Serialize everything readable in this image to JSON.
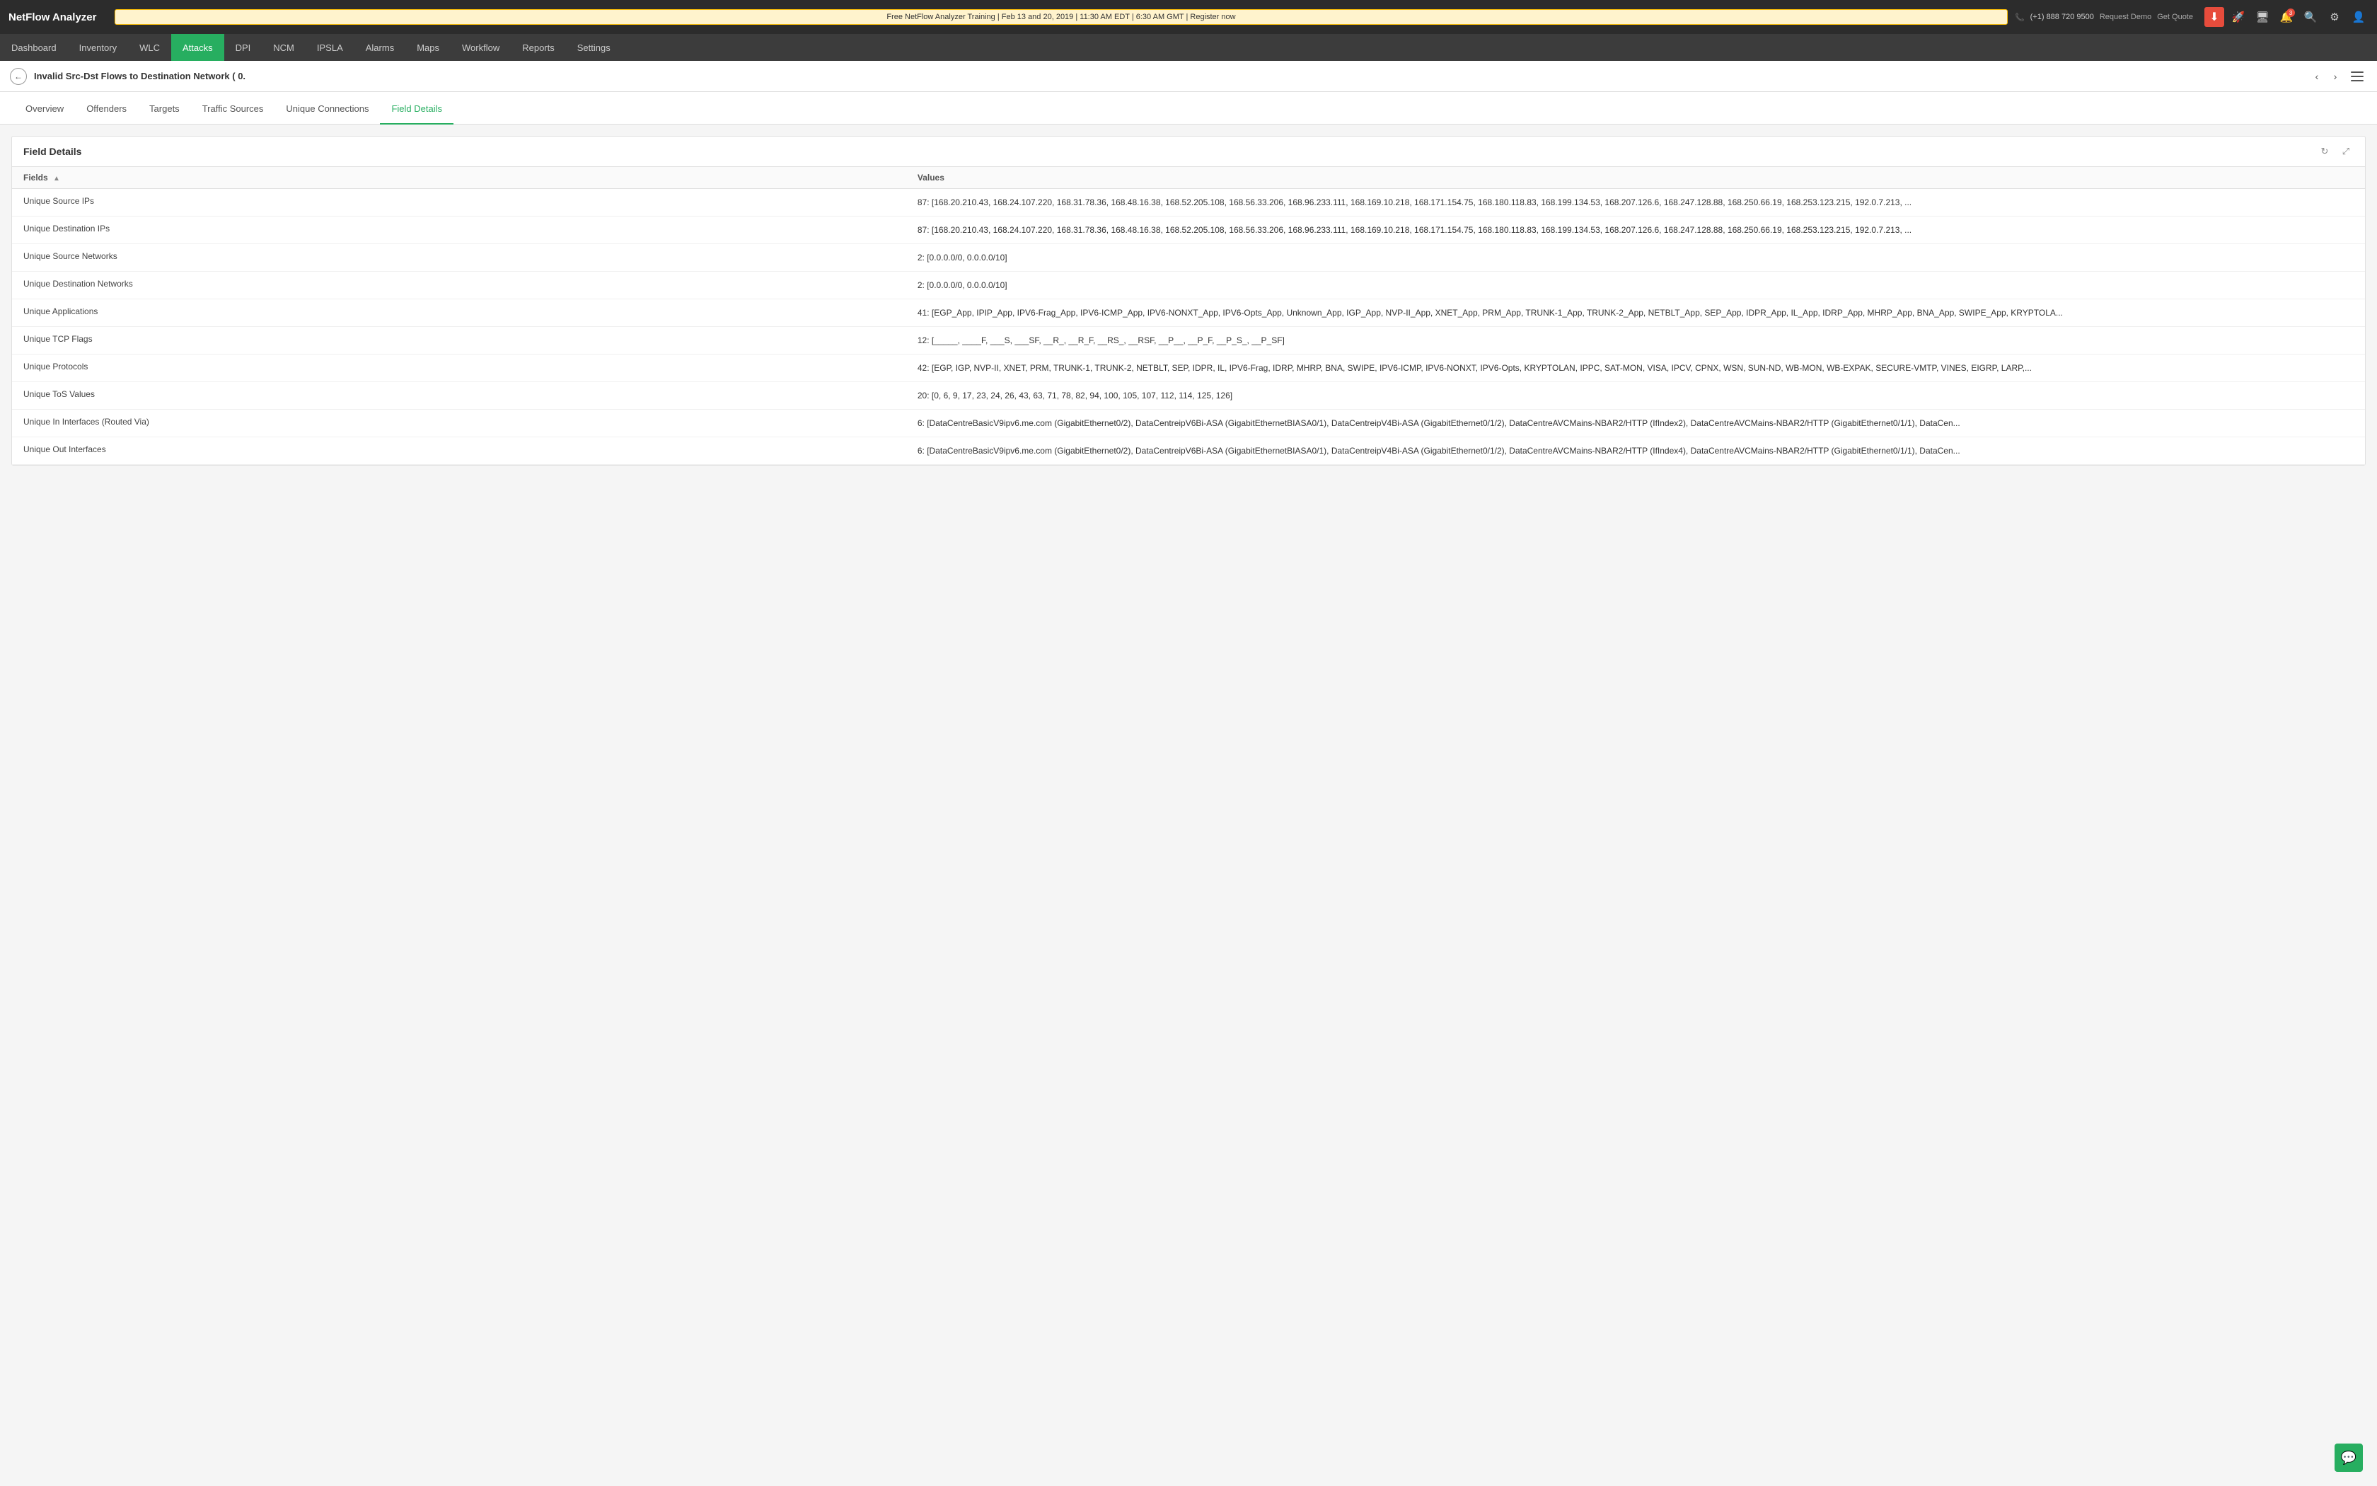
{
  "app": {
    "logo": "NetFlow Analyzer"
  },
  "announcement": {
    "text": "Free NetFlow Analyzer Training | Feb 13 and 20, 2019 | 11:30 AM EDT | 6:30 AM GMT | Register now"
  },
  "topActions": {
    "phone": "(+1) 888 720 9500",
    "request_demo": "Request Demo",
    "get_quote": "Get Quote"
  },
  "nav": {
    "items": [
      {
        "label": "Dashboard",
        "active": false
      },
      {
        "label": "Inventory",
        "active": false
      },
      {
        "label": "WLC",
        "active": false
      },
      {
        "label": "Attacks",
        "active": true
      },
      {
        "label": "DPI",
        "active": false
      },
      {
        "label": "NCM",
        "active": false
      },
      {
        "label": "IPSLA",
        "active": false
      },
      {
        "label": "Alarms",
        "active": false
      },
      {
        "label": "Maps",
        "active": false
      },
      {
        "label": "Workflow",
        "active": false
      },
      {
        "label": "Reports",
        "active": false
      },
      {
        "label": "Settings",
        "active": false
      }
    ]
  },
  "breadcrumb": {
    "title": "Invalid Src-Dst Flows to Destination Network ( 0."
  },
  "tabs": [
    {
      "label": "Overview",
      "active": false
    },
    {
      "label": "Offenders",
      "active": false
    },
    {
      "label": "Targets",
      "active": false
    },
    {
      "label": "Traffic Sources",
      "active": false
    },
    {
      "label": "Unique Connections",
      "active": false
    },
    {
      "label": "Field Details",
      "active": true
    }
  ],
  "fieldDetails": {
    "title": "Field Details",
    "columnsFields": "Fields",
    "columnsValues": "Values",
    "rows": [
      {
        "field": "Unique Source IPs",
        "value": "87: [168.20.210.43, 168.24.107.220, 168.31.78.36, 168.48.16.38, 168.52.205.108, 168.56.33.206, 168.96.233.111, 168.169.10.218, 168.171.154.75, 168.180.118.83, 168.199.134.53, 168.207.126.6, 168.247.128.88, 168.250.66.19, 168.253.123.215, 192.0.7.213, ..."
      },
      {
        "field": "Unique Destination IPs",
        "value": "87: [168.20.210.43, 168.24.107.220, 168.31.78.36, 168.48.16.38, 168.52.205.108, 168.56.33.206, 168.96.233.111, 168.169.10.218, 168.171.154.75, 168.180.118.83, 168.199.134.53, 168.207.126.6, 168.247.128.88, 168.250.66.19, 168.253.123.215, 192.0.7.213, ..."
      },
      {
        "field": "Unique Source Networks",
        "value": "2: [0.0.0.0/0, 0.0.0.0/10]"
      },
      {
        "field": "Unique Destination Networks",
        "value": "2: [0.0.0.0/0, 0.0.0.0/10]"
      },
      {
        "field": "Unique Applications",
        "value": "41: [EGP_App, IPIP_App, IPV6-Frag_App, IPV6-ICMP_App, IPV6-NONXT_App, IPV6-Opts_App, Unknown_App, IGP_App, NVP-II_App, XNET_App, PRM_App, TRUNK-1_App, TRUNK-2_App, NETBLT_App, SEP_App, IDPR_App, IL_App, IDRP_App, MHRP_App, BNA_App, SWIPE_App, KRYPTOLA..."
      },
      {
        "field": "Unique TCP Flags",
        "value": "12: [_____, ____F, ___S, ___SF, __R_, __R_F, __RS_, __RSF, __P__, __P_F, __P_S_, __P_SF]"
      },
      {
        "field": "Unique Protocols",
        "value": "42: [EGP, IGP, NVP-II, XNET, PRM, TRUNK-1, TRUNK-2, NETBLT, SEP, IDPR, IL, IPV6-Frag, IDRP, MHRP, BNA, SWIPE, IPV6-ICMP, IPV6-NONXT, IPV6-Opts, KRYPTOLAN, IPPC, SAT-MON, VISA, IPCV, CPNX, WSN, SUN-ND, WB-MON, WB-EXPAK, SECURE-VMTP, VINES, EIGRP, LARP,..."
      },
      {
        "field": "Unique ToS Values",
        "value": "20: [0, 6, 9, 17, 23, 24, 26, 43, 63, 71, 78, 82, 94, 100, 105, 107, 112, 114, 125, 126]"
      },
      {
        "field": "Unique In Interfaces (Routed Via)",
        "value": "6: [DataCentreBasicV9ipv6.me.com (GigabitEthernet0/2), DataCentreipV6Bi-ASA (GigabitEthernetBIASA0/1), DataCentreipV4Bi-ASA (GigabitEthernet0/1/2), DataCentreAVCMains-NBAR2/HTTP (IfIndex2), DataCentreAVCMains-NBAR2/HTTP (GigabitEthernet0/1/1), DataCen..."
      },
      {
        "field": "Unique Out Interfaces",
        "value": "6: [DataCentreBasicV9ipv6.me.com (GigabitEthernet0/2), DataCentreipV6Bi-ASA (GigabitEthernetBIASA0/1), DataCentreipV4Bi-ASA (GigabitEthernet0/1/2), DataCentreAVCMains-NBAR2/HTTP (IfIndex4), DataCentreAVCMains-NBAR2/HTTP (GigabitEthernet0/1/1), DataCen..."
      }
    ]
  },
  "notifications": {
    "badge": "3"
  }
}
